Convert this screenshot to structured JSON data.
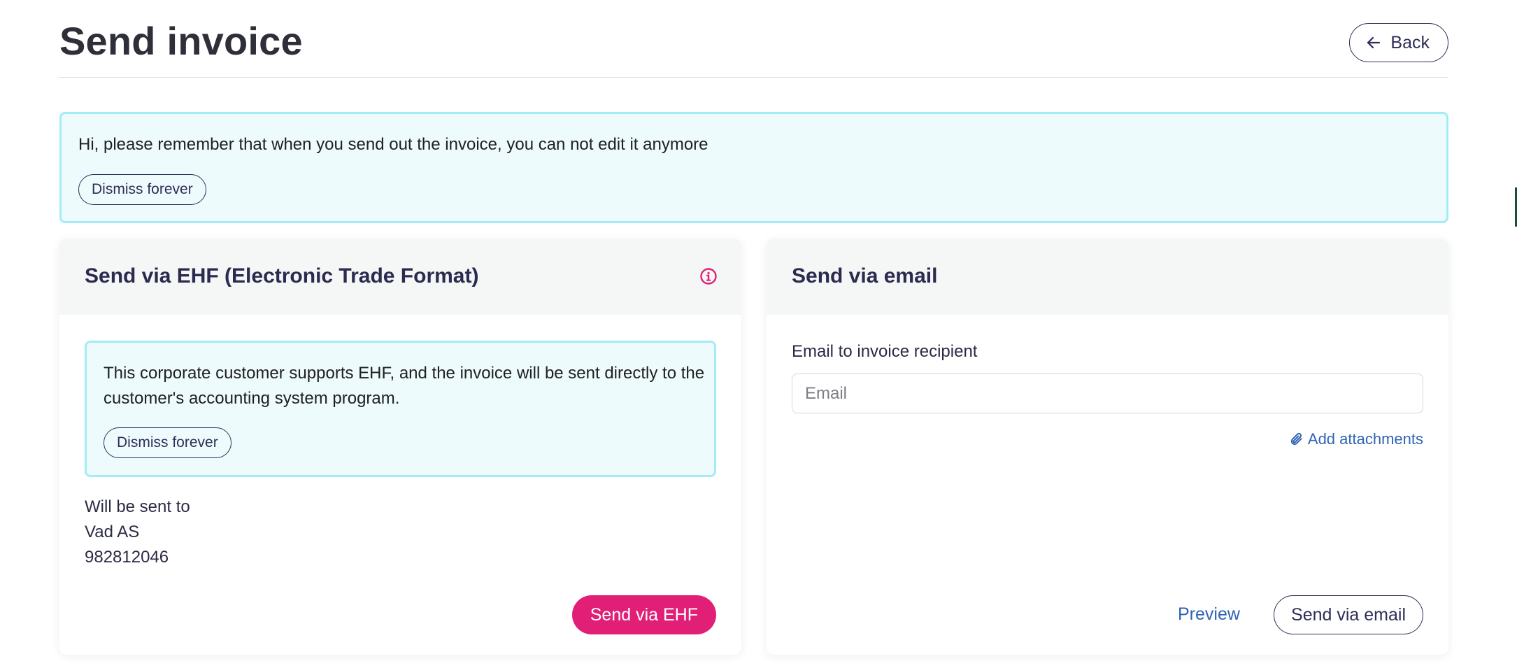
{
  "header": {
    "title": "Send invoice",
    "back_label": "Back"
  },
  "notice": {
    "message": "Hi, please remember that when you send out the invoice, you can not edit it anymore",
    "dismiss_label": "Dismiss forever"
  },
  "ehf_card": {
    "title": "Send via EHF (Electronic Trade Format)",
    "info_icon": "info-circle-icon",
    "notice_text": "This corporate customer supports EHF, and the invoice will be sent directly to the customer's accounting system program.",
    "dismiss_label": "Dismiss forever",
    "sent_to_label": "Will be sent to",
    "recipient_name": "Vad AS",
    "recipient_org_number": "982812046",
    "send_label": "Send via EHF"
  },
  "email_card": {
    "title": "Send via email",
    "field_label": "Email to invoice recipient",
    "email_value": "",
    "email_placeholder": "Email",
    "attach_label": "Add attachments",
    "attach_icon": "paperclip-icon",
    "preview_label": "Preview",
    "send_label": "Send via email"
  },
  "colors": {
    "accent_pink": "#e21f77",
    "link_blue": "#2f64b3",
    "notice_bg": "#eefbfd",
    "notice_border": "#a3ecf5",
    "navy": "#2e2e56"
  }
}
